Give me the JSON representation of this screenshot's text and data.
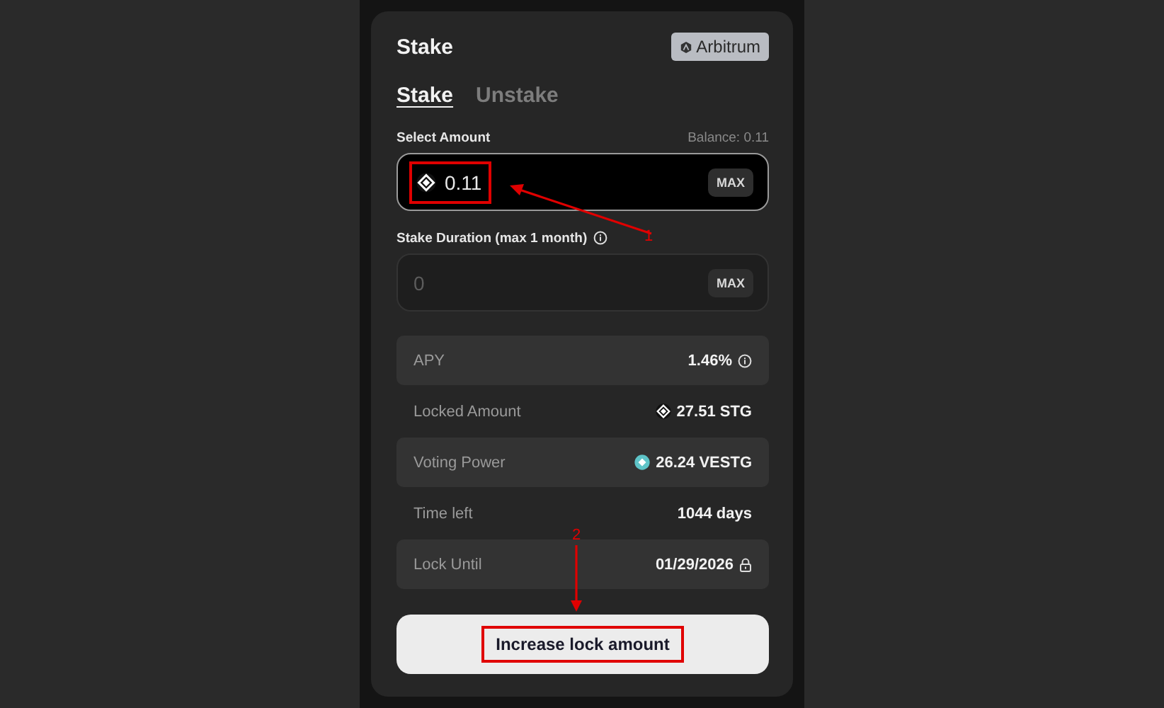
{
  "header": {
    "title": "Stake",
    "network": "Arbitrum"
  },
  "tabs": [
    {
      "label": "Stake",
      "selected": true
    },
    {
      "label": "Unstake",
      "selected": false
    }
  ],
  "amount": {
    "label": "Select Amount",
    "balance": "Balance: 0.11",
    "value": "0.11",
    "max": "MAX",
    "highlighted": true
  },
  "duration": {
    "label": "Stake Duration (max 1 month)",
    "placeholder": "0",
    "max": "MAX",
    "highlighted": false
  },
  "rows": [
    {
      "label": "APY",
      "value": "1.46%",
      "kind": "info"
    },
    {
      "label": "Locked Amount",
      "value": "27.51 STG",
      "kind": "token"
    },
    {
      "label": "Voting Power",
      "value": "26.24 VESTG",
      "kind": "vetoken"
    },
    {
      "label": "Time left",
      "value": "1044 days",
      "kind": "plain"
    },
    {
      "label": "Lock Until",
      "value": "01/29/2026",
      "kind": "lock"
    }
  ],
  "button": {
    "label": "Increase lock amount",
    "highlighted": true
  },
  "annotations": [
    {
      "label": "1",
      "kind": "diagonal"
    },
    {
      "label": "2",
      "kind": "down"
    }
  ]
}
